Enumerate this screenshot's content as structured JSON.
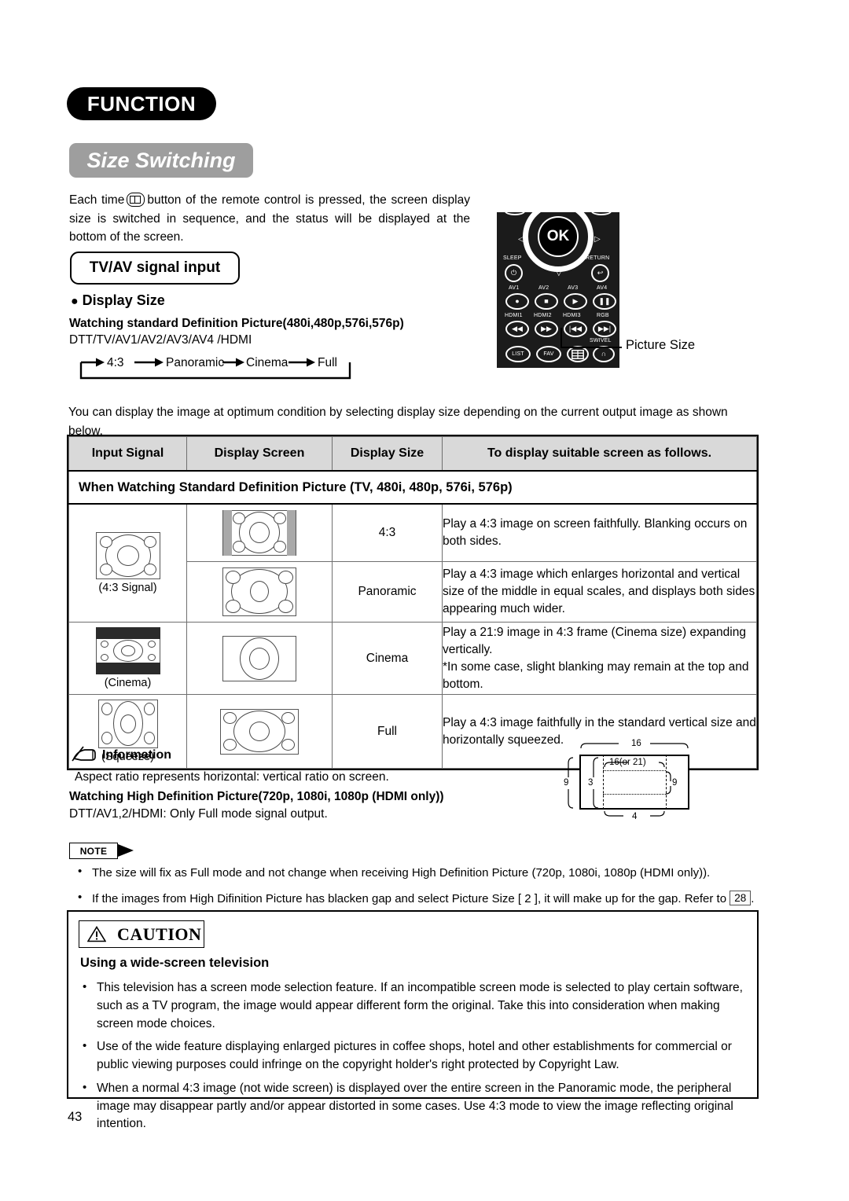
{
  "header": {
    "function_badge": "FUNCTION",
    "section_badge": "Size Switching"
  },
  "intro": {
    "before_icon": "Each time",
    "icon_name": "picture-size-icon",
    "after_icon": "button of the remote control is pressed, the screen display size is switched in sequence, and the status will be displayed at the bottom of the screen."
  },
  "tvav_box": {
    "label": "TV/AV signal input"
  },
  "display_size": {
    "heading": "Display Size",
    "sd_heading": "Watching standard Definition Picture(480i,480p,576i,576p)",
    "sources": "DTT/TV/AV1/AV2/AV3/AV4 /HDMI",
    "sequence": [
      "4:3",
      "Panoramic",
      "Cinema",
      "Full"
    ]
  },
  "remote": {
    "ok_label": "OK",
    "sleep_label": "SLEEP",
    "return_label": "RETURN",
    "swivel_label": "SWIVEL",
    "row_av": [
      {
        "label": "AV1",
        "glyph": "●"
      },
      {
        "label": "AV2",
        "glyph": "■"
      },
      {
        "label": "AV3",
        "glyph": "▶"
      },
      {
        "label": "AV4",
        "glyph": "❚❚"
      }
    ],
    "row_hdmi": [
      {
        "label": "HDMI1",
        "glyph": "◀◀"
      },
      {
        "label": "HDMI2",
        "glyph": "▶▶"
      },
      {
        "label": "HDMI3",
        "glyph": "|◀◀"
      },
      {
        "label": "RGB",
        "glyph": "▶▶|"
      }
    ],
    "row_bottom": [
      {
        "label": "LIST",
        "glyph": "LIST"
      },
      {
        "label": "FAV",
        "glyph": "FAV"
      },
      {
        "label": "picture-size",
        "glyph": ""
      },
      {
        "label": "headphone",
        "glyph": "∩"
      }
    ],
    "callout": "Picture Size"
  },
  "para2": "You can display the image at optimum condition by selecting display size depending on the current output image as shown below.",
  "table": {
    "headers": [
      "Input Signal",
      "Display Screen",
      "Display Size",
      "To display suitable screen as follows."
    ],
    "subheader": "When Watching Standard Definition Picture (TV, 480i, 480p, 576i, 576p)",
    "rows": [
      {
        "signal": "(4:3 Signal)",
        "screen_icon": "screen-4-3-pillarbox",
        "size": "4:3",
        "desc": "Play a 4:3 image on screen faithfully. Blanking occurs on both sides."
      },
      {
        "signal": "",
        "screen_icon": "screen-panoramic",
        "size": "Panoramic",
        "desc": "Play a 4:3 image which enlarges horizontal and vertical size of the middle in equal scales, and displays both sides appearing much wider."
      },
      {
        "signal": "(Cinema)",
        "screen_icon": "screen-cinema",
        "size": "Cinema",
        "desc": "Play a 21:9 image in 4:3 frame (Cinema size) expanding vertically.\n*In some case, slight blanking may remain at the top and bottom."
      },
      {
        "signal": "(Squeeze)",
        "screen_icon": "screen-full",
        "size": "Full",
        "desc": "Play a 4:3 image faithfully in the standard vertical size and horizontally squeezed."
      }
    ]
  },
  "information": {
    "heading": "Information",
    "line1": "Aspect ratio represents horizontal: vertical ratio on screen.",
    "hd_heading": "Watching High Definition Picture(720p, 1080i, 1080p (HDMI only))",
    "hd_line": "DTT/AV1,2/HDMI: Only Full mode signal output."
  },
  "aspect_diagram": {
    "top": "16",
    "inner_top": "16(or 21)",
    "left_outer": "9",
    "left_inner": "3",
    "right": "9",
    "bottom": "4"
  },
  "note": {
    "badge": "NOTE",
    "items": [
      "The size will fix as Full mode and not change when receiving High Definition Picture (720p, 1080i, 1080p (HDMI only)).",
      "If the images from High Difinition Picture has blacken gap and select Picture Size [ 2 ], it will make up for the gap. Refer to",
      "28"
    ]
  },
  "caution": {
    "badge": "CAUTION",
    "subheading": "Using a wide-screen television",
    "items": [
      "This television has a screen mode selection feature. If an incompatible screen mode is selected to play certain software, such as a TV program, the image would appear different form the original. Take this into consideration when making screen mode choices.",
      "Use of the wide feature displaying enlarged pictures in coffee shops, hotel and other establishments for commercial or public viewing purposes could infringe on the copyright holder's right protected by Copyright Law.",
      "When a normal 4:3 image (not wide screen) is displayed over the entire screen in the Panoramic mode, the peripheral image may disappear partly and/or appear distorted in some cases. Use 4:3 mode to view the image reflecting original intention."
    ]
  },
  "page_number": "43"
}
